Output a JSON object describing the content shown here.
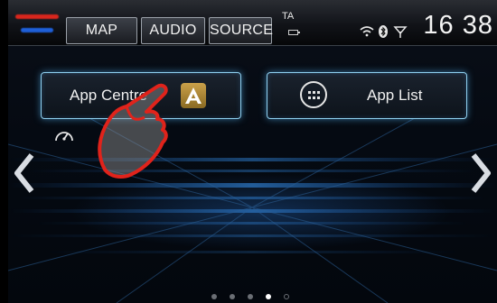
{
  "statusbar": {
    "map_label": "MAP",
    "audio_label": "AUDIO",
    "source_label": "SOURCE",
    "ta_label": "TA",
    "clock": "16 38",
    "icons": [
      "wifi-icon",
      "bluetooth-icon",
      "antenna-icon"
    ]
  },
  "apps": {
    "app_centre_label": "App Centre",
    "app_list_label": "App List"
  },
  "pager": {
    "pages": 5,
    "current": 4
  },
  "colors": {
    "accent_glow": "#8fd0f0",
    "brand_red": "#d8261d",
    "brand_blue": "#1e5fd8",
    "hand_red": "#e0231b"
  }
}
